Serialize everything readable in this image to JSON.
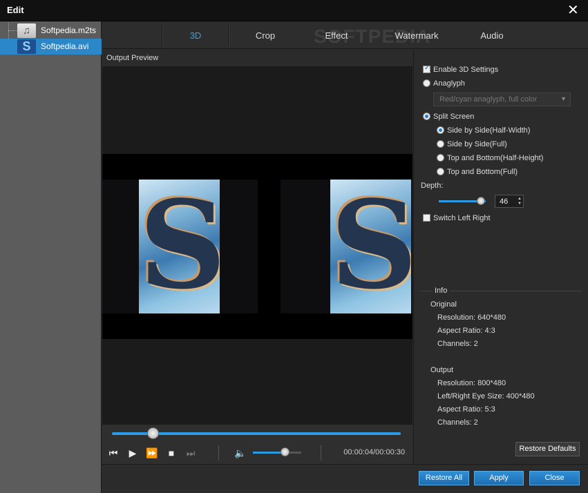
{
  "window": {
    "title": "Edit",
    "close_icon": "close-icon"
  },
  "files": [
    {
      "name": "Softpedia.m2ts",
      "icon": "audio-file-icon"
    },
    {
      "name": "Softpedia.avi",
      "icon": "video-file-icon",
      "selected": true
    }
  ],
  "tabs": [
    {
      "label": "3D",
      "active": true
    },
    {
      "label": "Crop"
    },
    {
      "label": "Effect"
    },
    {
      "label": "Watermark"
    },
    {
      "label": "Audio"
    }
  ],
  "watermark_text": "SOFTPEDIA",
  "preview": {
    "header": "Output Preview",
    "time": "00:00:04/00:00:30",
    "seek_fraction": 0.14,
    "volume_fraction": 0.65
  },
  "settings": {
    "enable_3d": {
      "label": "Enable 3D Settings",
      "checked": true
    },
    "anaglyph": {
      "label": "Anaglyph",
      "selected": false
    },
    "anaglyph_option": "Red/cyan anaglyph, full color",
    "split_screen": {
      "label": "Split Screen",
      "selected": true
    },
    "split_options": [
      {
        "label": "Side by Side(Half-Width)",
        "selected": true
      },
      {
        "label": "Side by Side(Full)"
      },
      {
        "label": "Top and Bottom(Half-Height)"
      },
      {
        "label": "Top and Bottom(Full)"
      }
    ],
    "depth_label": "Depth:",
    "depth_value": "46",
    "switch_left_right": {
      "label": "Switch Left Right",
      "checked": false
    }
  },
  "info": {
    "title": "Info",
    "original_heading": "Original",
    "original": {
      "resolution": "Resolution: 640*480",
      "aspect": "Aspect Ratio: 4:3",
      "channels": "Channels: 2"
    },
    "output_heading": "Output",
    "output": {
      "resolution": "Resolution: 800*480",
      "eye_size": "Left/Right Eye Size: 400*480",
      "aspect": "Aspect Ratio: 5:3",
      "channels": "Channels: 2"
    }
  },
  "buttons": {
    "restore_defaults": "Restore Defaults",
    "restore_all": "Restore All",
    "apply": "Apply",
    "close": "Close"
  }
}
